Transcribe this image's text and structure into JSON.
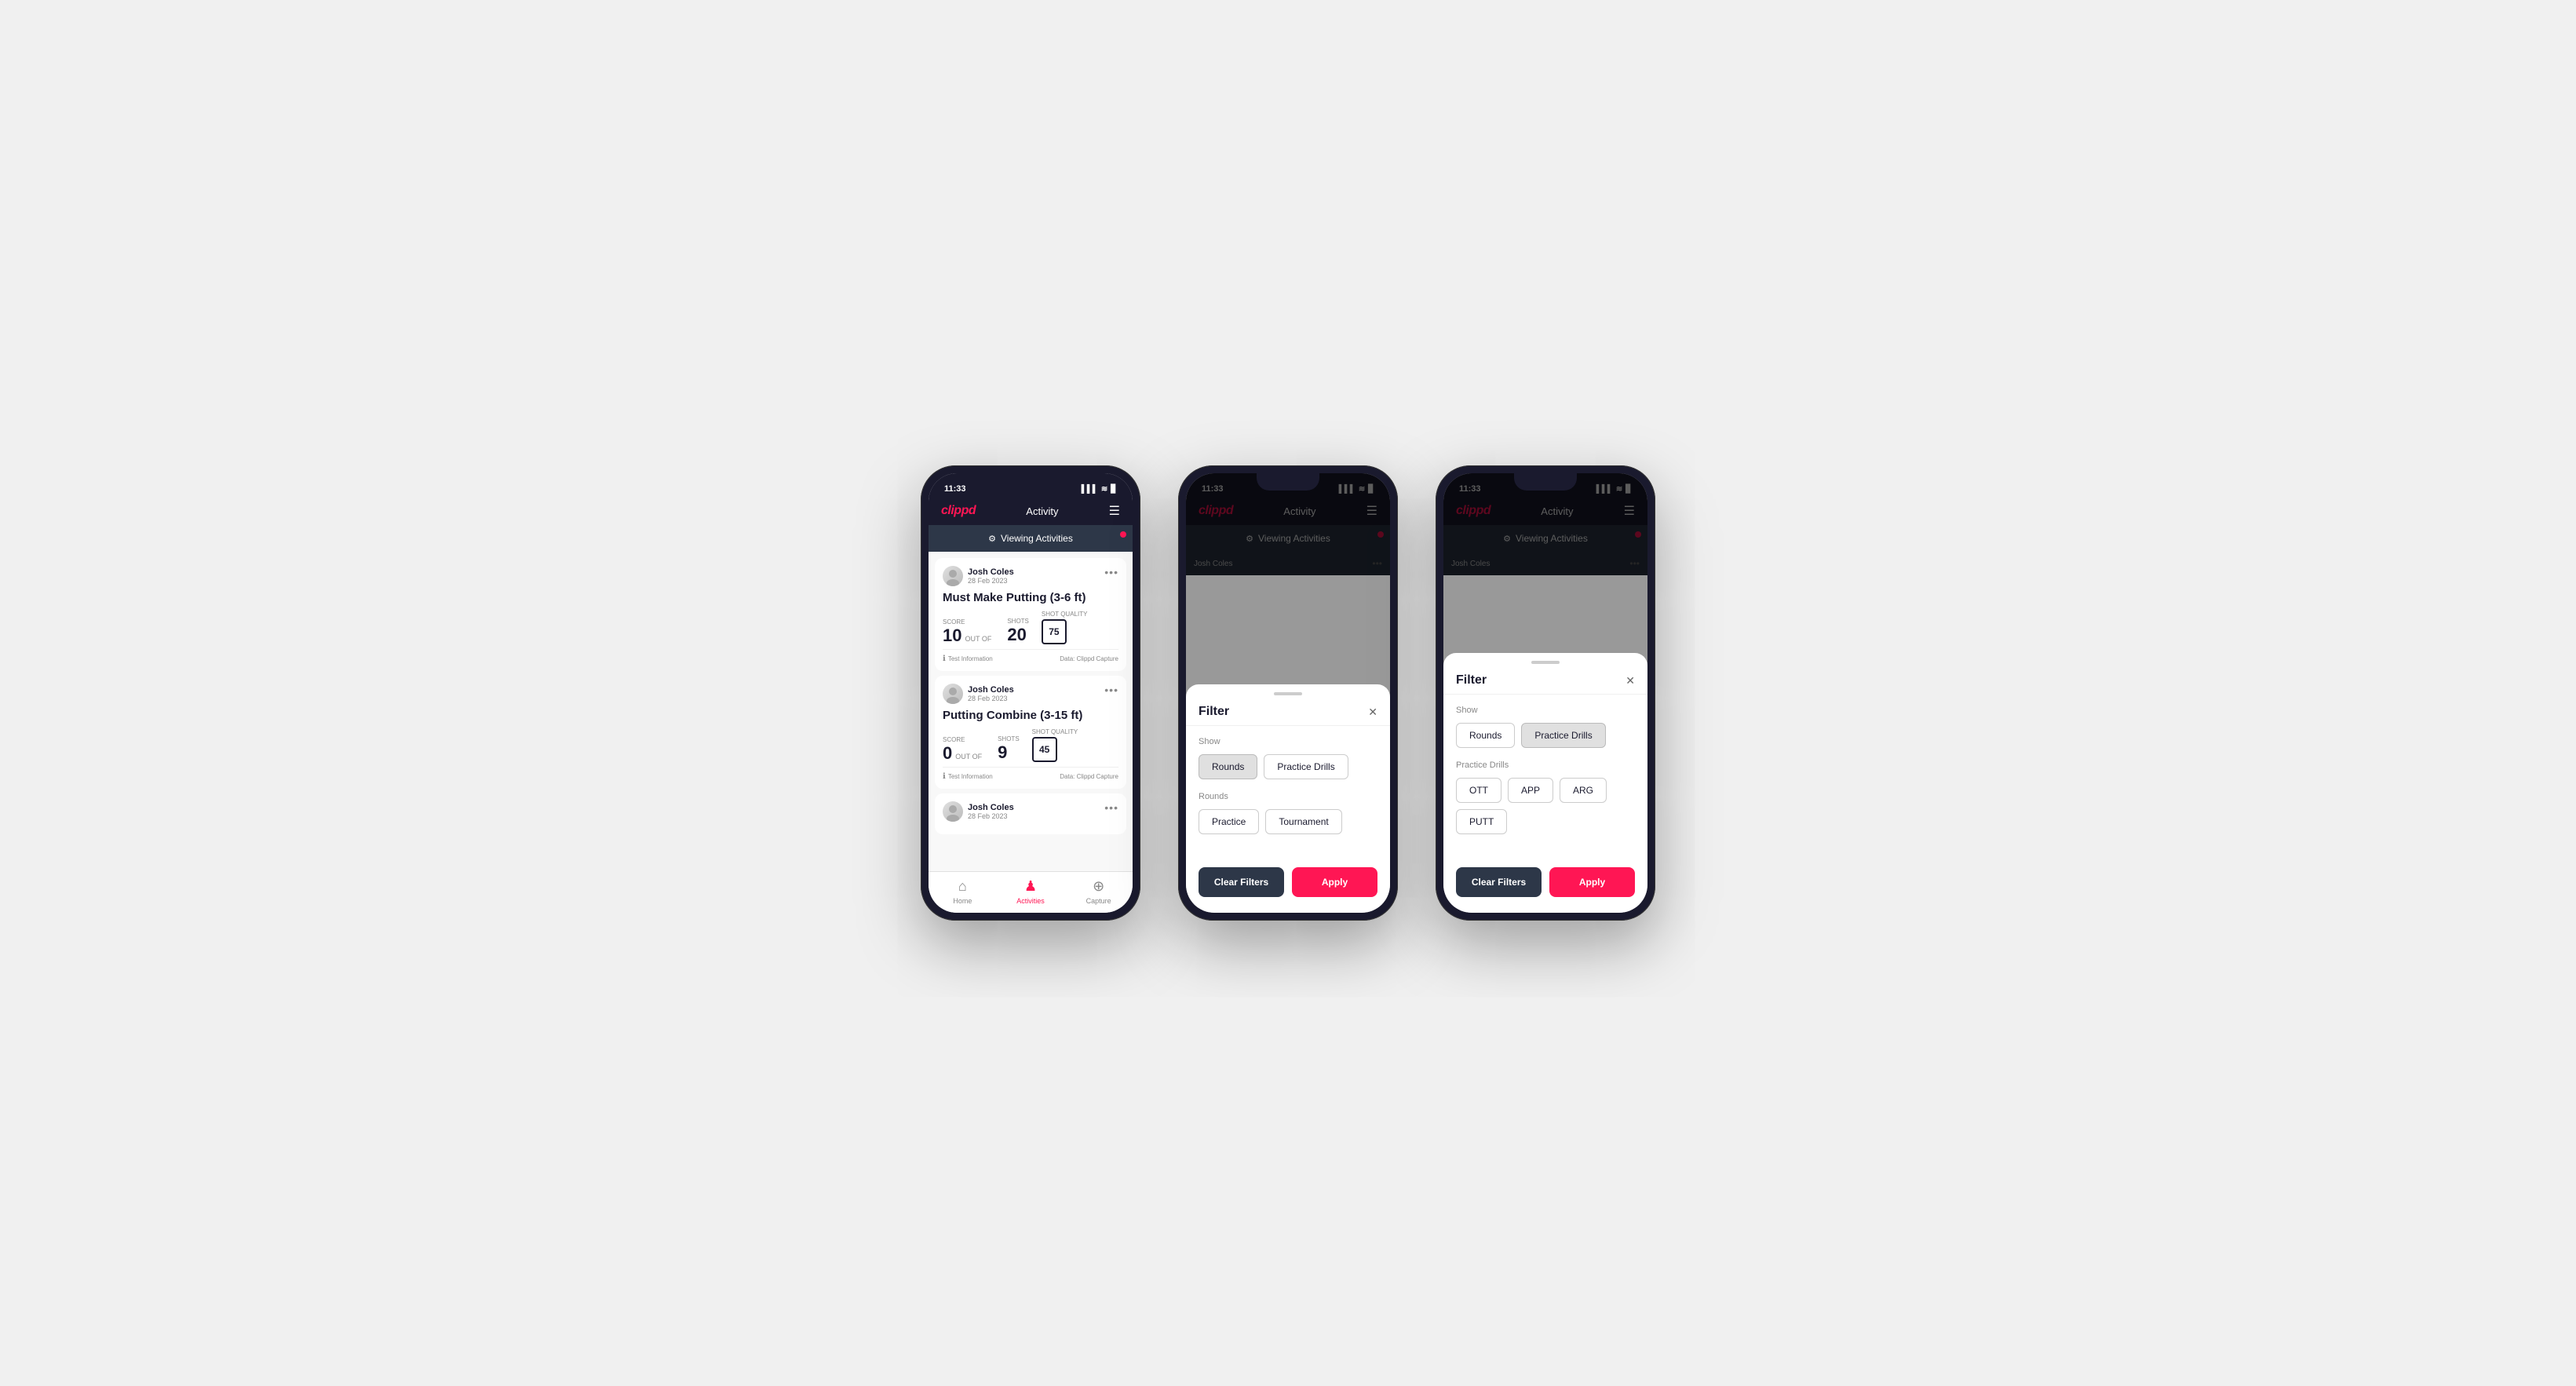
{
  "phones": [
    {
      "id": "phone1",
      "type": "activity_list",
      "status_time": "11:33",
      "nav_logo": "clippd",
      "nav_title": "Activity",
      "banner_text": "Viewing Activities",
      "activities": [
        {
          "user_name": "Josh Coles",
          "user_date": "28 Feb 2023",
          "title": "Must Make Putting (3-6 ft)",
          "score_label": "Score",
          "score_value": "10",
          "out_of_label": "OUT OF",
          "shots_label": "Shots",
          "shots_value": "20",
          "shot_quality_label": "Shot Quality",
          "shot_quality_value": "75",
          "info_text": "Test Information",
          "data_source": "Data: Clippd Capture"
        },
        {
          "user_name": "Josh Coles",
          "user_date": "28 Feb 2023",
          "title": "Putting Combine (3-15 ft)",
          "score_label": "Score",
          "score_value": "0",
          "out_of_label": "OUT OF",
          "shots_label": "Shots",
          "shots_value": "9",
          "shot_quality_label": "Shot Quality",
          "shot_quality_value": "45",
          "info_text": "Test Information",
          "data_source": "Data: Clippd Capture"
        },
        {
          "user_name": "Josh Coles",
          "user_date": "28 Feb 2023",
          "title": "",
          "score_label": "",
          "score_value": "",
          "out_of_label": "",
          "shots_label": "",
          "shots_value": "",
          "shot_quality_label": "",
          "shot_quality_value": "",
          "info_text": "",
          "data_source": ""
        }
      ],
      "tabs": [
        {
          "label": "Home",
          "icon": "⌂",
          "active": false
        },
        {
          "label": "Activities",
          "icon": "♟",
          "active": true
        },
        {
          "label": "Capture",
          "icon": "⊕",
          "active": false
        }
      ]
    },
    {
      "id": "phone2",
      "type": "filter_rounds",
      "status_time": "11:33",
      "nav_logo": "clippd",
      "nav_title": "Activity",
      "banner_text": "Viewing Activities",
      "filter": {
        "title": "Filter",
        "show_label": "Show",
        "show_buttons": [
          {
            "label": "Rounds",
            "active": true
          },
          {
            "label": "Practice Drills",
            "active": false
          }
        ],
        "rounds_label": "Rounds",
        "rounds_buttons": [
          {
            "label": "Practice",
            "active": false
          },
          {
            "label": "Tournament",
            "active": false
          }
        ],
        "clear_label": "Clear Filters",
        "apply_label": "Apply"
      }
    },
    {
      "id": "phone3",
      "type": "filter_practice",
      "status_time": "11:33",
      "nav_logo": "clippd",
      "nav_title": "Activity",
      "banner_text": "Viewing Activities",
      "filter": {
        "title": "Filter",
        "show_label": "Show",
        "show_buttons": [
          {
            "label": "Rounds",
            "active": false
          },
          {
            "label": "Practice Drills",
            "active": true
          }
        ],
        "practice_drills_label": "Practice Drills",
        "practice_drills_buttons": [
          {
            "label": "OTT",
            "active": false
          },
          {
            "label": "APP",
            "active": false
          },
          {
            "label": "ARG",
            "active": false
          },
          {
            "label": "PUTT",
            "active": false
          }
        ],
        "clear_label": "Clear Filters",
        "apply_label": "Apply"
      }
    }
  ],
  "icons": {
    "filter_icon": "⚙",
    "info_icon": "ℹ",
    "more_icon": "•••",
    "signal_icon": "▌▌▌",
    "wifi_icon": "🛜",
    "battery_icon": "▊"
  }
}
